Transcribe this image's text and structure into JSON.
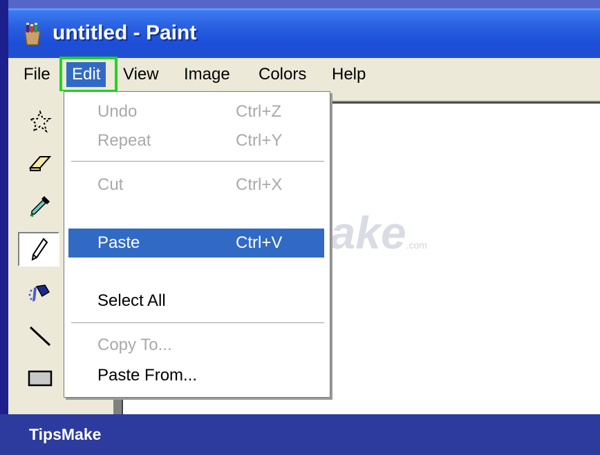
{
  "window": {
    "title": "untitled - Paint",
    "icon": "paint-brushes-icon"
  },
  "menubar": {
    "items": [
      {
        "label": "File"
      },
      {
        "label": "Edit",
        "active": true
      },
      {
        "label": "View"
      },
      {
        "label": "Image"
      },
      {
        "label": "Colors"
      },
      {
        "label": "Help"
      }
    ]
  },
  "edit_menu": {
    "items": [
      {
        "label": "Undo",
        "shortcut": "Ctrl+Z",
        "enabled": false
      },
      {
        "label": "Repeat",
        "shortcut": "Ctrl+Y",
        "enabled": false
      },
      {
        "label": "Cut",
        "shortcut": "Ctrl+X",
        "enabled": false
      },
      {
        "label": "Paste",
        "shortcut": "Ctrl+V",
        "enabled": true,
        "highlighted": true
      },
      {
        "label": "Select All",
        "shortcut": "",
        "enabled": true
      },
      {
        "label": "Copy To...",
        "shortcut": "",
        "enabled": false
      },
      {
        "label": "Paste From...",
        "shortcut": "",
        "enabled": true
      }
    ]
  },
  "toolbox": {
    "tools": [
      {
        "icon": "free-form-select-icon"
      },
      {
        "icon": "eraser-icon"
      },
      {
        "icon": "color-picker-icon"
      },
      {
        "icon": "pencil-icon",
        "selected": true
      },
      {
        "icon": "airbrush-icon"
      },
      {
        "icon": "line-icon"
      },
      {
        "icon": "rectangle-icon"
      }
    ]
  },
  "watermark": {
    "text": "TipsMake",
    "suffix": ".com"
  },
  "footer": {
    "brand": "TipsMake"
  },
  "colors": {
    "titlebar": "#2a5fe0",
    "menu_highlight": "#316ac5",
    "callout_box": "#22d322",
    "footer": "#2d3a9e"
  }
}
